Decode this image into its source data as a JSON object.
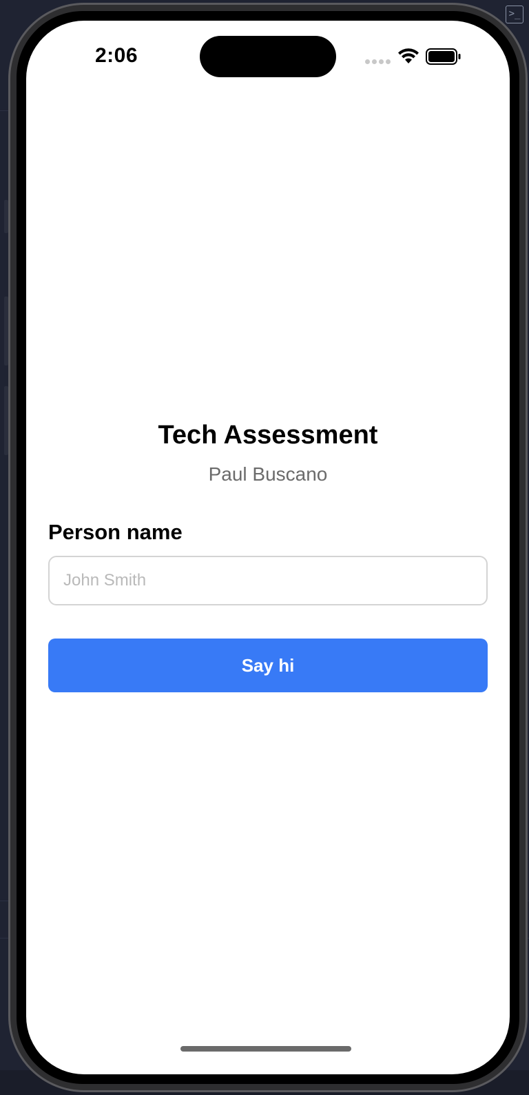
{
  "status_bar": {
    "time": "2:06"
  },
  "header": {
    "title": "Tech Assessment",
    "subtitle": "Paul Buscano"
  },
  "form": {
    "label": "Person name",
    "input_value": "",
    "input_placeholder": "John Smith",
    "button_label": "Say hi"
  },
  "colors": {
    "accent": "#387af6",
    "subtitle_text": "#6b6b6b",
    "placeholder_text": "#b9b9b9"
  },
  "icons": [
    "terminal-icon",
    "wifi-icon",
    "battery-icon",
    "signal-dots-icon"
  ]
}
